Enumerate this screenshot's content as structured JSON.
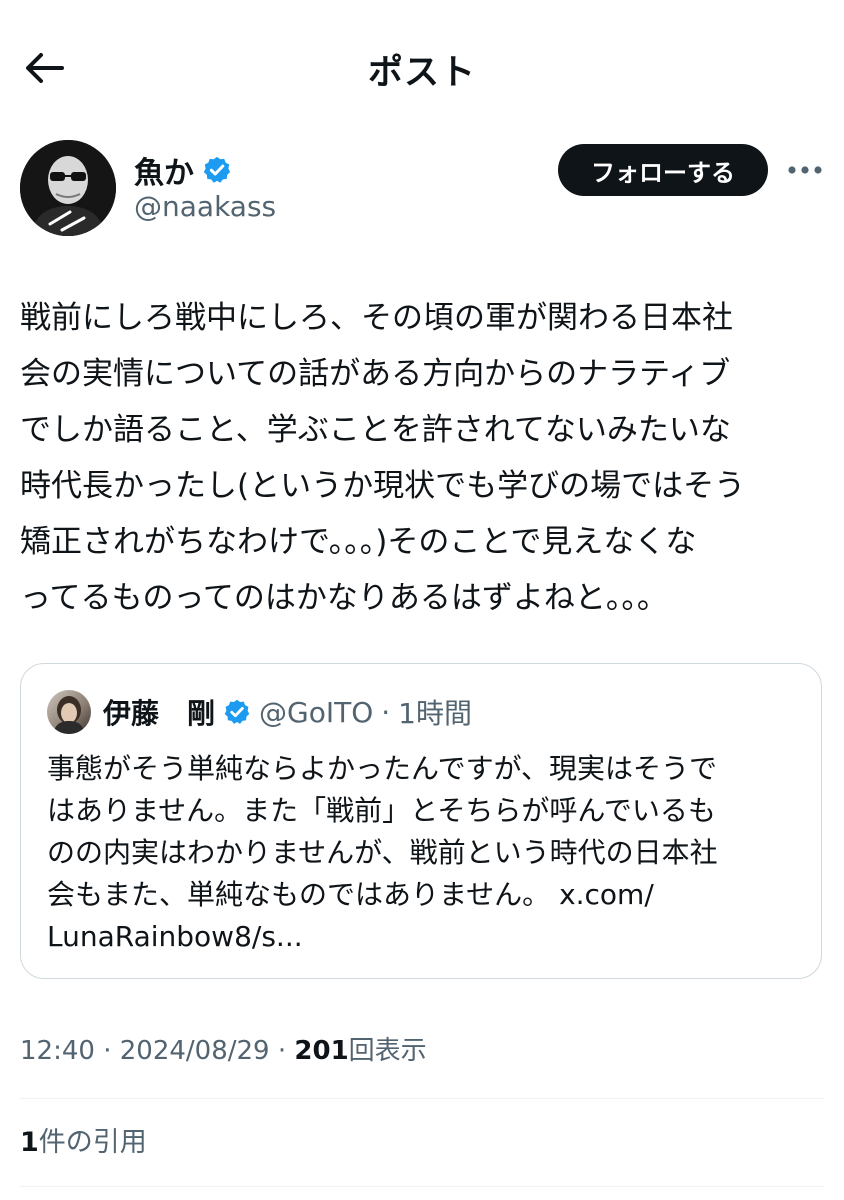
{
  "header": {
    "title": "ポスト",
    "back_icon": "arrow-left-icon"
  },
  "author": {
    "display_name": "魚か",
    "handle": "@naakass",
    "verified": true,
    "avatar_icon": "user-avatar"
  },
  "actions": {
    "follow_label": "フォローする",
    "more_icon": "more-horizontal-icon"
  },
  "tweet": {
    "text": "戦前にしろ戦中にしろ、その頃の軍が関わる日本社\n会の実情についての話がある方向からのナラティブ\nでしか語ること、学ぶことを許されてないみたいな\n時代長かったし(というか現状でも学びの場ではそう\n矯正されがちなわけで。。。)そのことで見えなくな\nってるものってのはかなりあるはずよねと。。。"
  },
  "quoted": {
    "display_name": "伊藤　剛",
    "verified": true,
    "handle": "@GoITO",
    "separator": "·",
    "time": "1時間",
    "text": "事態がそう単純ならよかったんですが、現実はそうで\nはありません。また「戦前」とそちらが呼んでいるも\nのの内実はわかりませんが、戦前という時代の日本社\n会もまた、単純なものではありません。 x.com/\nLunaRainbow8/s..."
  },
  "meta": {
    "time": "12:40",
    "sep1": "·",
    "date": "2024/08/29",
    "sep2": "·",
    "views_count": "201",
    "views_label": "回表示"
  },
  "quotes": {
    "count": "1",
    "label": "件の引用"
  },
  "colors": {
    "text": "#0f1419",
    "secondary": "#536471",
    "verified": "#1d9bf0",
    "border": "#cfd9de"
  }
}
